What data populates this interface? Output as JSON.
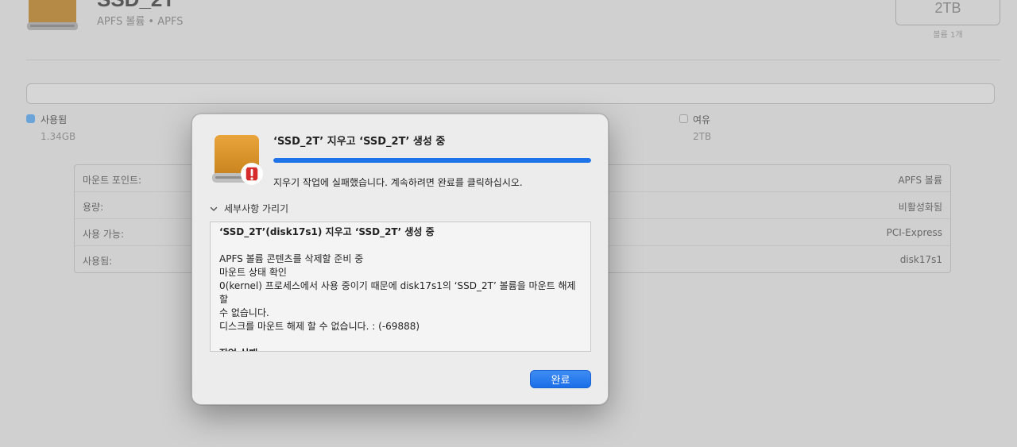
{
  "background": {
    "volume_title": "SSD_2T",
    "volume_subtitle": "APFS 볼륨 • APFS",
    "capacity": "2TB",
    "capacity_sub": "볼륨 1개",
    "legend": {
      "used_label": "사용됨",
      "used_value": "1.34GB",
      "free_label": "여유",
      "free_value": "2TB",
      "used_color": "#6aa4d9"
    },
    "info_rows": [
      {
        "key": "마운트 포인트:",
        "value": "APFS 볼륨"
      },
      {
        "key": "용량:",
        "value": "비활성화됨"
      },
      {
        "key": "사용 가능:",
        "value": "PCI-Express"
      },
      {
        "key": "사용됨:",
        "value": "disk17s1"
      }
    ]
  },
  "dialog": {
    "title": "‘SSD_2T’ 지우고 ‘SSD_2T’ 생성 중",
    "progress": 1.0,
    "message": "지우기 작업에 실패했습니다. 계속하려면 완료를 클릭하십시오.",
    "details_toggle_label": "세부사항 가리기",
    "log_lines": [
      {
        "text": "‘SSD_2T’(disk17s1) 지우고 ‘SSD_2T’ 생성 중",
        "bold": true
      },
      {
        "text": "",
        "bold": false
      },
      {
        "text": "APFS 볼륨 콘텐츠를 삭제할 준비 중",
        "bold": false
      },
      {
        "text": "마운트 상태 확인",
        "bold": false
      },
      {
        "text": "0(kernel) 프로세스에서 사용 중이기 때문에 disk17s1의 ‘SSD_2T’ 볼륨을 마운트 해제할",
        "bold": false
      },
      {
        "text": "수 없습니다.",
        "bold": false
      },
      {
        "text": "디스크를 마운트 해제 할 수 없습니다. : (-69888)",
        "bold": false
      },
      {
        "text": "",
        "bold": false
      },
      {
        "text": "작업 실패…",
        "bold": true
      }
    ],
    "done_label": "완료",
    "accent_color": "#1e73e8"
  }
}
